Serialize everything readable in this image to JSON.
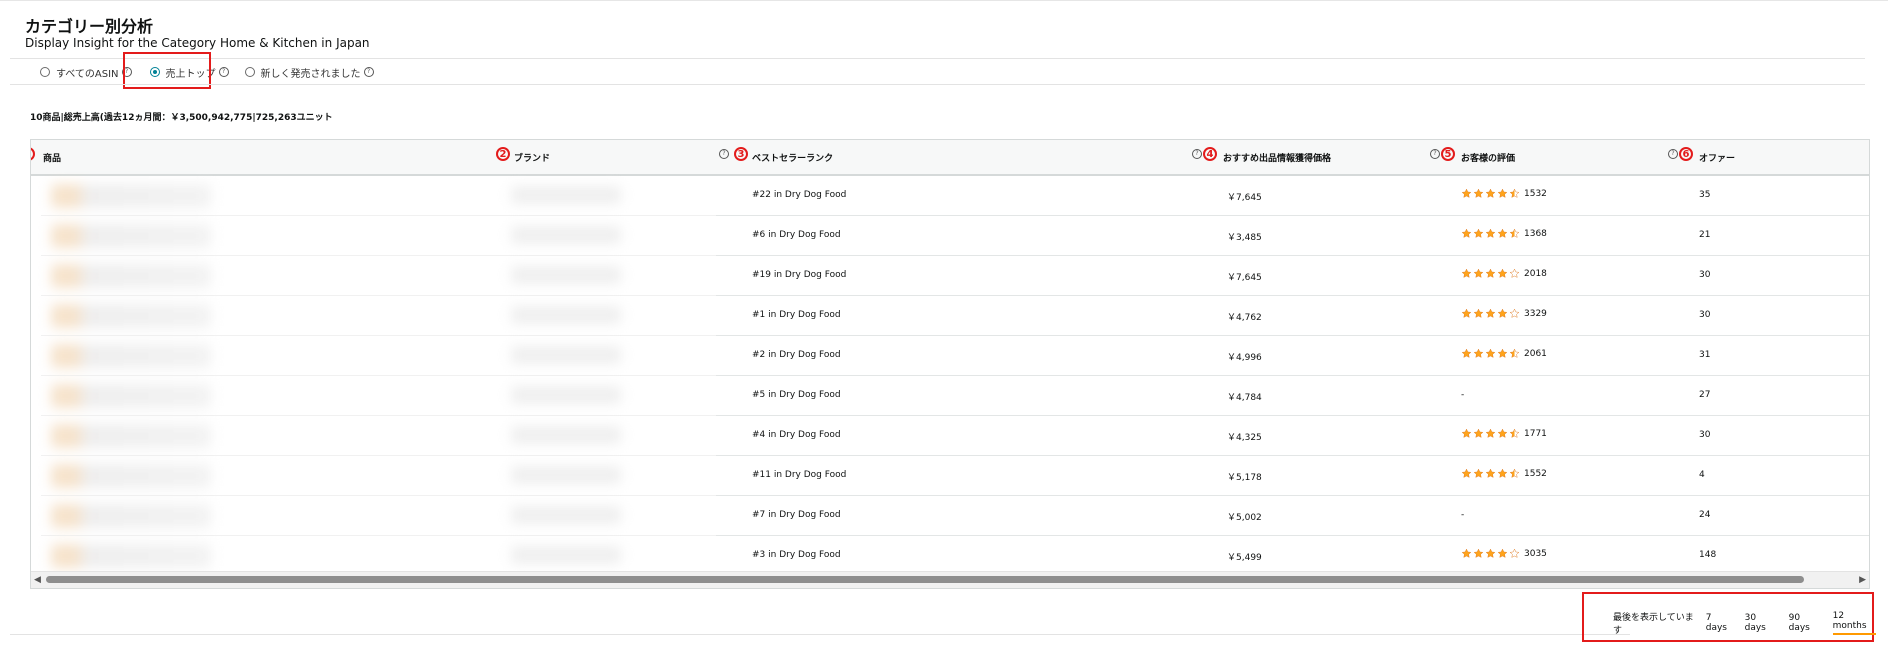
{
  "header": {
    "title": "カテゴリー別分析",
    "subtitle": "Display Insight for the Category Home & Kitchen in Japan"
  },
  "filters": {
    "options": [
      {
        "label": "すべてのASIN",
        "selected": false
      },
      {
        "label": "売上トップ",
        "selected": true
      },
      {
        "label": "新しく発売されました",
        "selected": false
      }
    ]
  },
  "summary": "10商品|総売上高(過去12ヵ月間：￥3,500,942,775|725,263ユニット",
  "table": {
    "columns": [
      {
        "marker": "1",
        "label": "商品"
      },
      {
        "marker": "2",
        "label": "ブランド"
      },
      {
        "marker": "3",
        "label": "ベストセラーランク"
      },
      {
        "marker": "4",
        "label": "おすすめ出品情報獲得価格"
      },
      {
        "marker": "5",
        "label": "お客様の評価"
      },
      {
        "marker": "6",
        "label": "オファー"
      }
    ],
    "rows": [
      {
        "rank": "#22 in Dry Dog Food",
        "price": "￥7,645",
        "rating": 4.5,
        "reviews": "1532",
        "offers": "35"
      },
      {
        "rank": "#6 in Dry Dog Food",
        "price": "￥3,485",
        "rating": 4.5,
        "reviews": "1368",
        "offers": "21"
      },
      {
        "rank": "#19 in Dry Dog Food",
        "price": "￥7,645",
        "rating": 4,
        "reviews": "2018",
        "offers": "30"
      },
      {
        "rank": "#1 in Dry Dog Food",
        "price": "￥4,762",
        "rating": 4,
        "reviews": "3329",
        "offers": "30"
      },
      {
        "rank": "#2 in Dry Dog Food",
        "price": "￥4,996",
        "rating": 4.5,
        "reviews": "2061",
        "offers": "31"
      },
      {
        "rank": "#5 in Dry Dog Food",
        "price": "￥4,784",
        "rating": null,
        "reviews": "-",
        "offers": "27"
      },
      {
        "rank": "#4 in Dry Dog Food",
        "price": "￥4,325",
        "rating": 4.5,
        "reviews": "1771",
        "offers": "30"
      },
      {
        "rank": "#11 in Dry Dog Food",
        "price": "￥5,178",
        "rating": 4.5,
        "reviews": "1552",
        "offers": "4"
      },
      {
        "rank": "#7 in Dry Dog Food",
        "price": "￥5,002",
        "rating": null,
        "reviews": "-",
        "offers": "24"
      },
      {
        "rank": "#3 in Dry Dog Food",
        "price": "￥5,499",
        "rating": 4,
        "reviews": "3035",
        "offers": "148"
      }
    ]
  },
  "time_range": {
    "label": "最後を表示しています",
    "options": [
      "7 days",
      "30 days",
      "90 days",
      "12 months"
    ],
    "selected": "12 months"
  },
  "colors": {
    "accent": "#008296",
    "star": "#ffa41c",
    "highlight": "#e31b1b",
    "tab_underline": "#ff9900"
  },
  "icons": {
    "help": "help-circle-icon",
    "star": "star-icon",
    "scroll_left": "arrow-left-icon",
    "scroll_right": "arrow-right-icon"
  }
}
